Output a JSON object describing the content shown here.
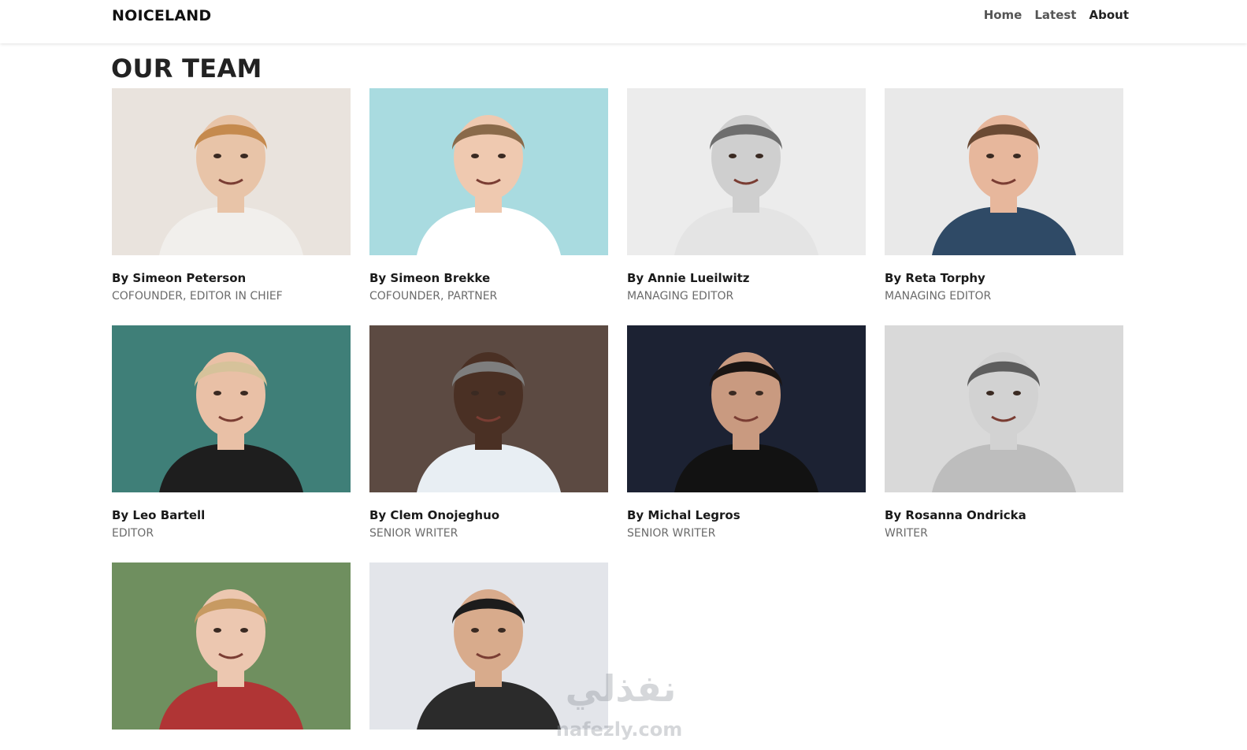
{
  "nav": {
    "brand": "NOICELAND",
    "links": [
      {
        "label": "Home"
      },
      {
        "label": "Latest"
      },
      {
        "label": "About"
      }
    ]
  },
  "page": {
    "title": "OUR TEAM"
  },
  "team": [
    {
      "name": "By Simeon Peterson",
      "role": "COFOUNDER, EDITOR IN CHIEF",
      "bg": "#e9e3dd",
      "skin": "#e8c4a8",
      "hair": "#c58a4e",
      "shirt": "#f1efec"
    },
    {
      "name": "By Simeon Brekke",
      "role": "COFOUNDER, PARTNER",
      "bg": "#a9dbe0",
      "skin": "#efc9b0",
      "hair": "#8a6a4a",
      "shirt": "#ffffff"
    },
    {
      "name": "By Annie Lueilwitz",
      "role": "MANAGING EDITOR",
      "bg": "#ececec",
      "skin": "#cfcfcf",
      "hair": "#6e6e6e",
      "shirt": "#e4e4e4"
    },
    {
      "name": "By Reta Torphy",
      "role": "MANAGING EDITOR",
      "bg": "#e9e9e9",
      "skin": "#e7b79c",
      "hair": "#6b4a34",
      "shirt": "#2f4a66"
    },
    {
      "name": "By Leo Bartell",
      "role": "EDITOR",
      "bg": "#3f7f78",
      "skin": "#e9c0a6",
      "hair": "#d6c29a",
      "shirt": "#1e1e1e"
    },
    {
      "name": "By Clem Onojeghuo",
      "role": "SENIOR WRITER",
      "bg": "#5c4a42",
      "skin": "#4a3024",
      "hair": "#7e7e7e",
      "shirt": "#e8eef3"
    },
    {
      "name": "By Michal Legros",
      "role": "SENIOR WRITER",
      "bg": "#1c2233",
      "skin": "#c99a80",
      "hair": "#1a1513",
      "shirt": "#121212"
    },
    {
      "name": "By Rosanna Ondricka",
      "role": "WRITER",
      "bg": "#d9d9d9",
      "skin": "#d2d2d2",
      "hair": "#5e5e5e",
      "shirt": "#bdbdbd"
    },
    {
      "name": "",
      "role": "",
      "bg": "#6f8f5f",
      "skin": "#ecc7b0",
      "hair": "#c79a62",
      "shirt": "#b03535"
    },
    {
      "name": "",
      "role": "",
      "bg": "#e3e5ea",
      "skin": "#d8ab8c",
      "hair": "#1c1c1c",
      "shirt": "#2b2b2b"
    }
  ],
  "watermark": {
    "arabic": "نفذلي",
    "latin": "nafezly.com"
  }
}
